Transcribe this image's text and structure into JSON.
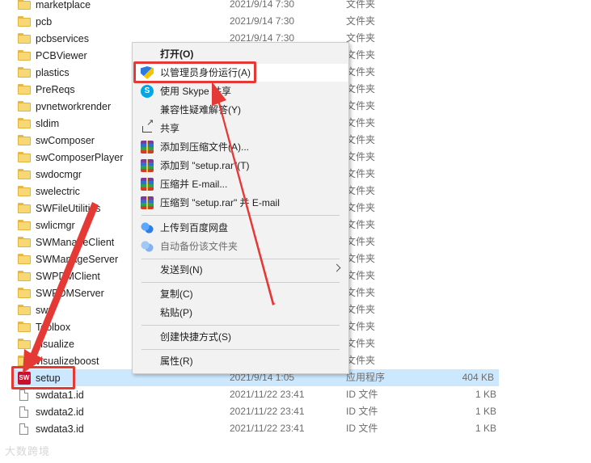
{
  "files": [
    {
      "name": "marketplace",
      "date": "2021/9/14 7:30",
      "type": "文件夹",
      "size": "",
      "kind": "folder"
    },
    {
      "name": "pcb",
      "date": "2021/9/14 7:30",
      "type": "文件夹",
      "size": "",
      "kind": "folder"
    },
    {
      "name": "pcbservices",
      "date": "2021/9/14 7:30",
      "type": "文件夹",
      "size": "",
      "kind": "folder"
    },
    {
      "name": "PCBViewer",
      "date": "",
      "type": "文件夹",
      "size": "",
      "kind": "folder"
    },
    {
      "name": "plastics",
      "date": "",
      "type": "文件夹",
      "size": "",
      "kind": "folder"
    },
    {
      "name": "PreReqs",
      "date": "",
      "type": "文件夹",
      "size": "",
      "kind": "folder"
    },
    {
      "name": "pvnetworkrender",
      "date": "",
      "type": "文件夹",
      "size": "",
      "kind": "folder"
    },
    {
      "name": "sldim",
      "date": "",
      "type": "文件夹",
      "size": "",
      "kind": "folder"
    },
    {
      "name": "swComposer",
      "date": "",
      "type": "文件夹",
      "size": "",
      "kind": "folder"
    },
    {
      "name": "swComposerPlayer",
      "date": "",
      "type": "文件夹",
      "size": "",
      "kind": "folder"
    },
    {
      "name": "swdocmgr",
      "date": "",
      "type": "文件夹",
      "size": "",
      "kind": "folder"
    },
    {
      "name": "swelectric",
      "date": "",
      "type": "文件夹",
      "size": "",
      "kind": "folder"
    },
    {
      "name": "SWFileUtilities",
      "date": "",
      "type": "文件夹",
      "size": "",
      "kind": "folder"
    },
    {
      "name": "swlicmgr",
      "date": "",
      "type": "文件夹",
      "size": "",
      "kind": "folder"
    },
    {
      "name": "SWManageClient",
      "date": "",
      "type": "文件夹",
      "size": "",
      "kind": "folder"
    },
    {
      "name": "SWManageServer",
      "date": "",
      "type": "文件夹",
      "size": "",
      "kind": "folder"
    },
    {
      "name": "SWPDMClient",
      "date": "",
      "type": "文件夹",
      "size": "",
      "kind": "folder"
    },
    {
      "name": "SWPDMServer",
      "date": "",
      "type": "文件夹",
      "size": "",
      "kind": "folder"
    },
    {
      "name": "swri",
      "date": "",
      "type": "文件夹",
      "size": "",
      "kind": "folder"
    },
    {
      "name": "Toolbox",
      "date": "",
      "type": "文件夹",
      "size": "",
      "kind": "folder"
    },
    {
      "name": "visualize",
      "date": "",
      "type": "文件夹",
      "size": "",
      "kind": "folder"
    },
    {
      "name": "visualizeboost",
      "date": "",
      "type": "文件夹",
      "size": "",
      "kind": "folder"
    },
    {
      "name": "setup",
      "date": "2021/9/14 1:05",
      "type": "应用程序",
      "size": "404 KB",
      "kind": "app"
    },
    {
      "name": "swdata1.id",
      "date": "2021/11/22 23:41",
      "type": "ID 文件",
      "size": "1 KB",
      "kind": "doc"
    },
    {
      "name": "swdata2.id",
      "date": "2021/11/22 23:41",
      "type": "ID 文件",
      "size": "1 KB",
      "kind": "doc"
    },
    {
      "name": "swdata3.id",
      "date": "2021/11/22 23:41",
      "type": "ID 文件",
      "size": "1 KB",
      "kind": "doc"
    }
  ],
  "context_menu": {
    "open": "打开(O)",
    "run_as_admin": "以管理员身份运行(A)",
    "share_skype": "使用 Skype 共享",
    "troubleshoot": "兼容性疑难解答(Y)",
    "share": "共享",
    "add_to_archive": "添加到压缩文件(A)...",
    "add_to_rar": "添加到 \"setup.rar\"(T)",
    "compress_email": "压缩并 E-mail...",
    "compress_rar_email": "压缩到 \"setup.rar\" 并 E-mail",
    "upload_baidu": "上传到百度网盘",
    "auto_backup": "自动备份该文件夹",
    "send_to": "发送到(N)",
    "copy": "复制(C)",
    "paste": "粘贴(P)",
    "create_shortcut": "创建快捷方式(S)",
    "properties": "属性(R)"
  },
  "watermark": "大数跨境",
  "annotation_color": "#e53935"
}
